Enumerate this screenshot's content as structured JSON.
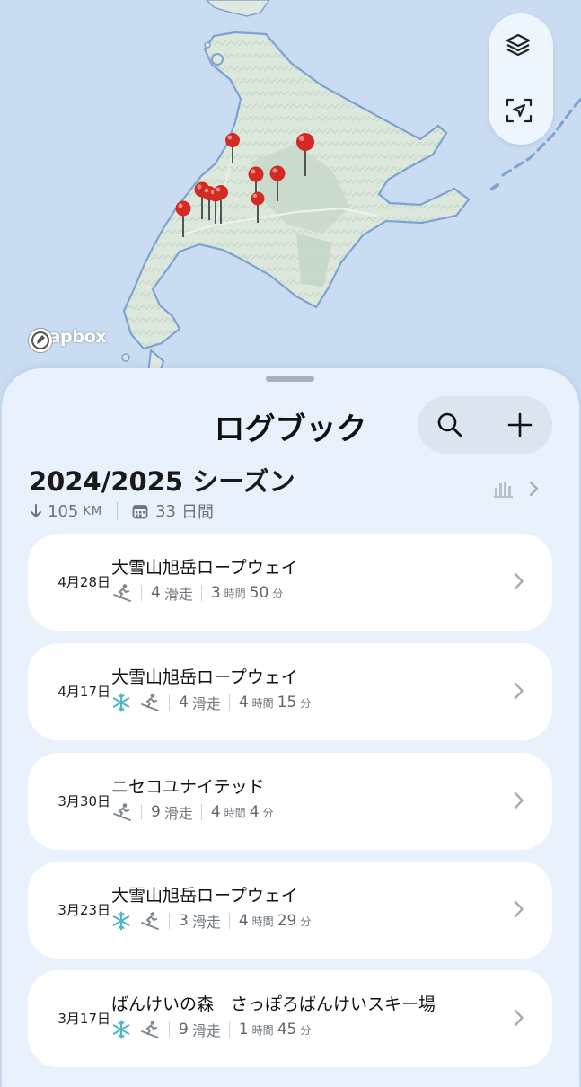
{
  "map": {
    "attribution_logo": "mapbox",
    "controls": [
      "layers-icon",
      "locate-icon"
    ],
    "pin_color": "#d42a24",
    "water_color": "#c9dcf1",
    "land_color": "#dfe9e0"
  },
  "sheet": {
    "title": "ログブック",
    "actions": [
      "search-icon",
      "plus-icon"
    ]
  },
  "season": {
    "title": "2024/2025 シーズン",
    "distance_value": "105",
    "distance_unit": "KM",
    "days_value": "33",
    "days_label": "日間"
  },
  "sessions": [
    {
      "date": "4月28日",
      "name": "大雪山旭岳ロープウェイ",
      "snow": false,
      "runs_value": "4",
      "runs_label": "滑走",
      "hours": "3",
      "hours_unit": "時間",
      "minutes": "50",
      "minutes_unit": "分"
    },
    {
      "date": "4月17日",
      "name": "大雪山旭岳ロープウェイ",
      "snow": true,
      "runs_value": "4",
      "runs_label": "滑走",
      "hours": "4",
      "hours_unit": "時間",
      "minutes": "15",
      "minutes_unit": "分"
    },
    {
      "date": "3月30日",
      "name": "ニセコユナイテッド",
      "snow": false,
      "runs_value": "9",
      "runs_label": "滑走",
      "hours": "4",
      "hours_unit": "時間",
      "minutes": "4",
      "minutes_unit": "分"
    },
    {
      "date": "3月23日",
      "name": "大雪山旭岳ロープウェイ",
      "snow": true,
      "runs_value": "3",
      "runs_label": "滑走",
      "hours": "4",
      "hours_unit": "時間",
      "minutes": "29",
      "minutes_unit": "分"
    },
    {
      "date": "3月17日",
      "name": "ばんけいの森　さっぽろばんけいスキー場",
      "snow": true,
      "runs_value": "9",
      "runs_label": "滑走",
      "hours": "1",
      "hours_unit": "時間",
      "minutes": "45",
      "minutes_unit": "分"
    }
  ]
}
